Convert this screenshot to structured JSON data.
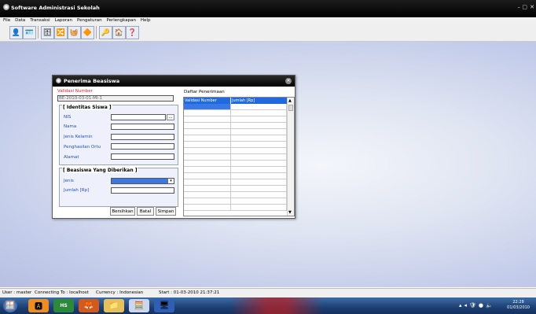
{
  "app": {
    "title": "Software Administrasi Sekolah",
    "window_controls": [
      "–",
      "▢",
      "✕"
    ]
  },
  "menu": [
    "File",
    "Data",
    "Transaksi",
    "Laporan",
    "Pengaturan",
    "Perlengkapan",
    "Help"
  ],
  "toolbar": {
    "buttons": [
      {
        "name": "user-icon",
        "glyph": "👤"
      },
      {
        "name": "card-icon",
        "glyph": "🪪"
      },
      {
        "name": "database-icon",
        "glyph": "🗄"
      },
      {
        "name": "network-icon",
        "glyph": "🔀"
      },
      {
        "name": "bucket-icon",
        "glyph": "🧺"
      },
      {
        "name": "tag-icon",
        "glyph": "🔶"
      },
      {
        "name": "key-icon",
        "glyph": "🔑"
      },
      {
        "name": "home-icon",
        "glyph": "🏠"
      },
      {
        "name": "help-icon",
        "glyph": "❓"
      }
    ]
  },
  "dialog": {
    "title": "Penerima Beasiswa",
    "validasi_label": "Validasi Number",
    "validasi_value": "BE-2010-03-01-MI-1",
    "identitas": {
      "title": "[ Identitas Siswa ]",
      "fields": [
        {
          "label": "NIS",
          "value": ""
        },
        {
          "label": "Nama",
          "value": ""
        },
        {
          "label": "Jenis Kelamin",
          "value": ""
        },
        {
          "label": "Penghasilan Ortu",
          "value": ""
        },
        {
          "label": "Alamat",
          "value": ""
        }
      ],
      "lookup_button": "..."
    },
    "beasiswa": {
      "title": "[ Beasiswa Yang Diberikan ]",
      "jenis_label": "Jenis",
      "jumlah_label": "Jumlah [Rp]"
    },
    "buttons": {
      "clear": "Bersihkan",
      "cancel": "Batal",
      "save": "Simpan"
    },
    "grid": {
      "title": "Daftar Penerimaan",
      "columns": [
        "Validasi Number",
        "Jumlah [Rp]"
      ]
    }
  },
  "status": {
    "user": "User : master",
    "conn": "Connecting To : localhost",
    "currency": "Currency : Indonesian",
    "start": "Start : 01-03-2010 21:37:21"
  },
  "taskbar": {
    "time": "22:28",
    "date": "01/03/2010",
    "apps": [
      {
        "name": "start-orb-icon",
        "glyph": "🪟"
      },
      {
        "name": "app-ai-icon",
        "glyph": "🅰"
      },
      {
        "name": "app-hs-icon",
        "glyph": "HS"
      },
      {
        "name": "browser-icon",
        "glyph": "🦊"
      },
      {
        "name": "folder-icon",
        "glyph": "📁"
      },
      {
        "name": "calculator-icon",
        "glyph": "🧮"
      },
      {
        "name": "app-window-icon",
        "glyph": "🖥"
      }
    ]
  }
}
